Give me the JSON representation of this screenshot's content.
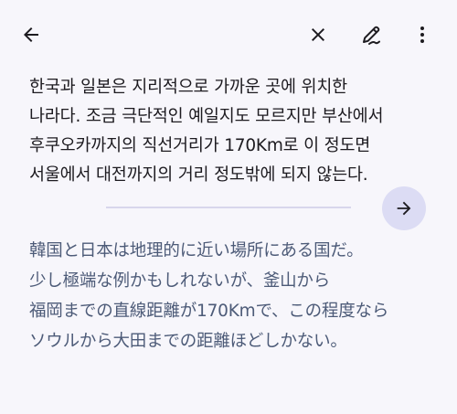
{
  "toolbar": {
    "back_icon": "arrow-back-icon",
    "close_icon": "close-icon",
    "edit_icon": "edit-pen-icon",
    "more_icon": "more-vert-icon"
  },
  "source": {
    "lines": [
      "한국과 일본은 지리적으로 가까운 곳에 위치한",
      "나라다. 조금 극단적인 예일지도 모르지만 부산에서",
      "후쿠오카까지의 직선거리가 170Km로 이 정도면",
      "서울에서 대전까지의 거리 정도밖에 되지 않는다."
    ]
  },
  "action": {
    "go_icon": "arrow-forward-icon"
  },
  "translation": {
    "lines": [
      "韓国と日本は地理的に近い場所にある国だ。",
      "少し極端な例かもしれないが、釜山から",
      "福岡までの直線距離が170Kmで、この程度なら",
      "ソウルから大田までの距離ほどしかない。"
    ]
  },
  "colors": {
    "background": "#f7f6fb",
    "source_text": "#1d1b20",
    "translation_text": "#4d5b78",
    "accent_button": "#dcdcf4",
    "divider": "#d8d6ec"
  }
}
